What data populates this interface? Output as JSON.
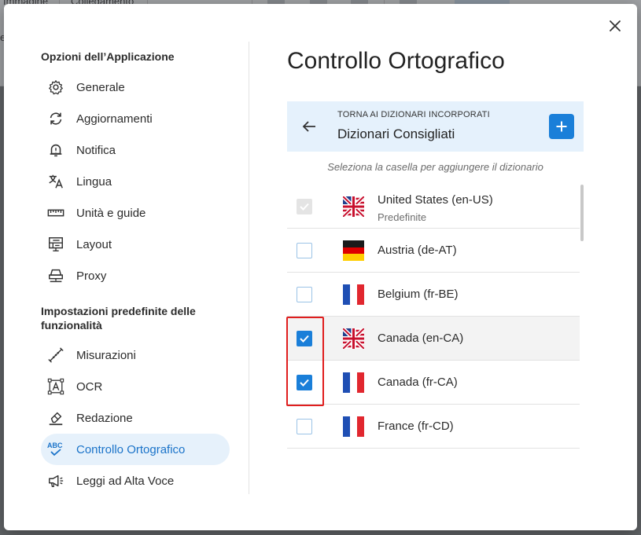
{
  "background_toolbar": {
    "labels": [
      "Immagine",
      "Collegamento"
    ],
    "edge_char": "e"
  },
  "dialog": {
    "close_label": "×"
  },
  "sidebar": {
    "section_app": "Opzioni dell’Applicazione",
    "app_items": [
      {
        "label": "Generale",
        "icon": "gear-icon"
      },
      {
        "label": "Aggiornamenti",
        "icon": "refresh-icon"
      },
      {
        "label": "Notifica",
        "icon": "bell-icon"
      },
      {
        "label": "Lingua",
        "icon": "translate-icon"
      },
      {
        "label": "Unità e guide",
        "icon": "ruler-icon"
      },
      {
        "label": "Layout",
        "icon": "layout-icon"
      },
      {
        "label": "Proxy",
        "icon": "proxy-icon"
      }
    ],
    "section_features": "Impostazioni predefinite delle funzionalità",
    "feature_items": [
      {
        "label": "Misurazioni",
        "icon": "measure-icon"
      },
      {
        "label": "OCR",
        "icon": "ocr-icon"
      },
      {
        "label": "Redazione",
        "icon": "eraser-icon"
      },
      {
        "label": "Controllo Ortografico",
        "icon": "spellcheck-icon",
        "active": true
      },
      {
        "label": "Leggi ad Alta Voce",
        "icon": "megaphone-icon"
      }
    ]
  },
  "main": {
    "title": "Controllo Ortografico",
    "header": {
      "back_link": "TORNA AI DIZIONARI INCORPORATI",
      "title": "Dizionari Consigliati",
      "add_label": "+"
    },
    "hint": "Seleziona la casella per aggiungere il dizionario",
    "dictionaries": [
      {
        "name": "United States (en-US)",
        "sub": "Predefinite",
        "flag": "us-uk-flag",
        "checked": true,
        "disabled": true
      },
      {
        "name": "Austria (de-AT)",
        "sub": "",
        "flag": "germany-flag",
        "checked": false,
        "disabled": false
      },
      {
        "name": "Belgium (fr-BE)",
        "sub": "",
        "flag": "france-flag",
        "checked": false,
        "disabled": false
      },
      {
        "name": "Canada (en-CA)",
        "sub": "",
        "flag": "us-uk-flag",
        "checked": true,
        "disabled": false
      },
      {
        "name": "Canada (fr-CA)",
        "sub": "",
        "flag": "france-flag",
        "checked": true,
        "disabled": false
      },
      {
        "name": "France (fr-CD)",
        "sub": "",
        "flag": "france-flag",
        "checked": false,
        "disabled": false
      }
    ]
  },
  "colors": {
    "accent": "#1a7fd9",
    "highlight": "#e01e1e",
    "header_bg": "#e5f1fc",
    "active_nav_bg": "#e6f1fb"
  }
}
